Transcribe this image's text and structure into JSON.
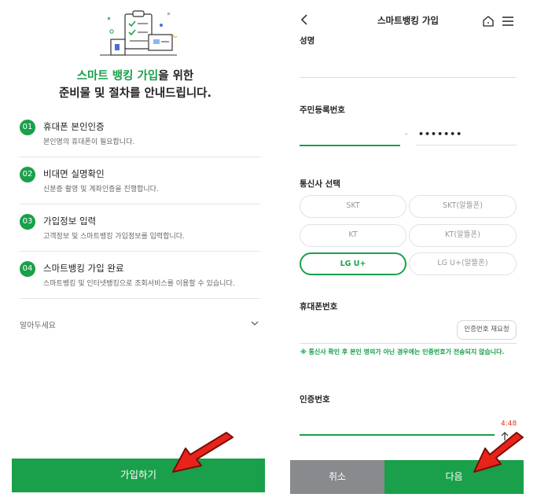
{
  "left": {
    "headline_highlight": "스마트 뱅킹 가입",
    "headline_rest": "을 위한",
    "headline_line2": "준비물 및 절차를 안내드립니다.",
    "steps": [
      {
        "num": "01",
        "title": "휴대폰 본인인증",
        "desc": "본인명의 휴대폰이 필요합니다."
      },
      {
        "num": "02",
        "title": "비대면 실명확인",
        "desc": "신분증 촬영 및 계좌인증을 진행합니다."
      },
      {
        "num": "03",
        "title": "가입정보 입력",
        "desc": "고객정보 및 스마트뱅킹 가입정보를 입력합니다."
      },
      {
        "num": "04",
        "title": "스마트뱅킹 가입 완료",
        "desc": "스마트뱅킹 및 인터넷뱅킹으로 조회서비스를 이용할 수 있습니다."
      }
    ],
    "notice_label": "알아두세요",
    "join_button": "가입하기"
  },
  "right": {
    "title": "스마트뱅킹 가입",
    "name_label": "성명",
    "rrn_label": "주민등록번호",
    "rrn_dash": "-",
    "rrn_back_masked": "•••••••",
    "carrier_label": "통신사 선택",
    "carriers": [
      "SKT",
      "SKT(알뜰폰)",
      "KT",
      "KT(알뜰폰)",
      "LG U+",
      "LG U+(알뜰폰)"
    ],
    "carrier_selected": "LG U+",
    "phone_label": "휴대폰번호",
    "resend_button": "인증번호 재요청",
    "warning": "※ 통신사 확인 후 본인 명의가 아닌 경우에는 인증번호가 전송되지 않습니다.",
    "auth_label": "인증번호",
    "timer": "4:48",
    "cancel_button": "취소",
    "next_button": "다음"
  },
  "colors": {
    "brand_green": "#1aa04a",
    "cancel_gray": "#888a8d",
    "timer_red": "#e0341c",
    "arrow_red": "#e8231a"
  }
}
